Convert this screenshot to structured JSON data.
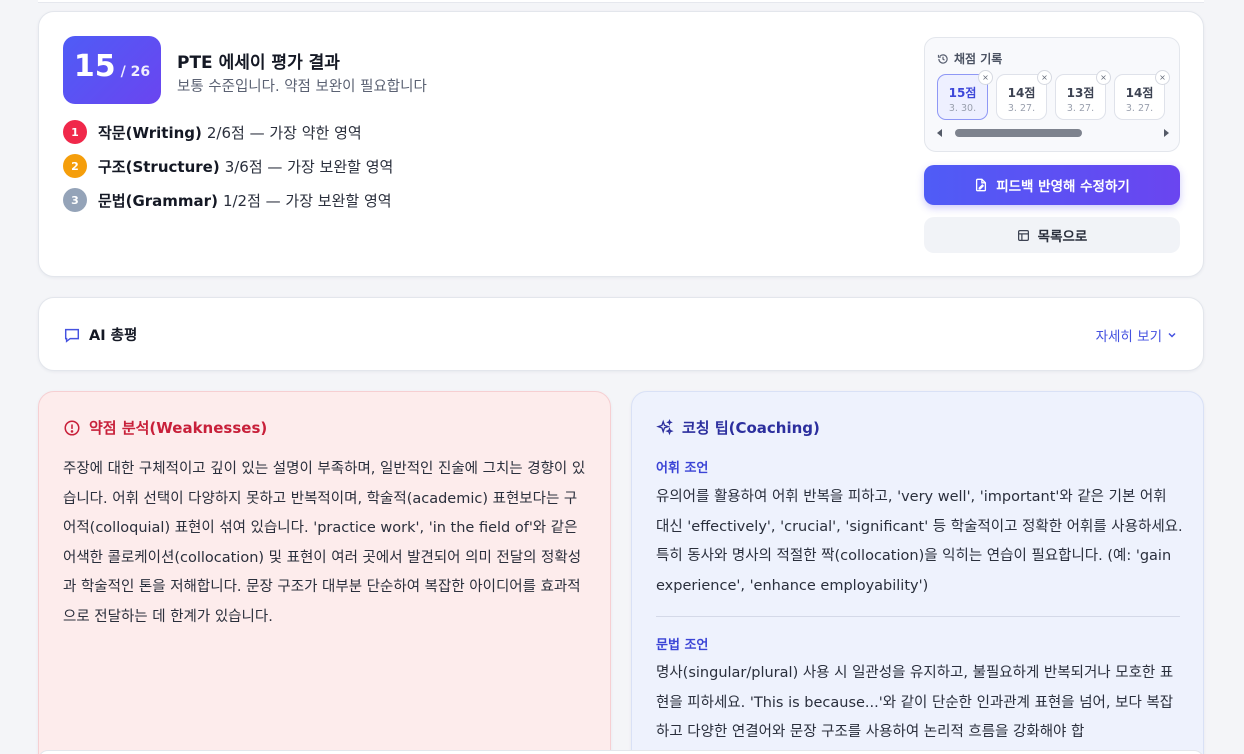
{
  "result": {
    "score": "15",
    "score_total": "/ 26",
    "title": "PTE 에세이 평가 결과",
    "subtitle": "보통 수준입니다. 약점 보완이 필요합니다",
    "weak_items": [
      {
        "num": "1",
        "name": "작문(Writing)",
        "detail": "2/6점 — 가장 약한 영역",
        "color": "#f0284a"
      },
      {
        "num": "2",
        "name": "구조(Structure)",
        "detail": "3/6점 — 가장 보완할 영역",
        "color": "#f59e0b"
      },
      {
        "num": "3",
        "name": "문법(Grammar)",
        "detail": "1/2점 — 가장 보완할 영역",
        "color": "#94a3b8"
      }
    ]
  },
  "history": {
    "label": "채점 기록",
    "items": [
      {
        "score": "15점",
        "date": "3. 30.",
        "active": true
      },
      {
        "score": "14점",
        "date": "3. 27.",
        "active": false
      },
      {
        "score": "13점",
        "date": "3. 27.",
        "active": false
      },
      {
        "score": "14점",
        "date": "3. 27.",
        "active": false
      }
    ],
    "remove_glyph": "×"
  },
  "buttons": {
    "revise": "피드백 반영해 수정하기",
    "list": "목록으로"
  },
  "summary": {
    "title": "AI 총평",
    "detail_link": "자세히 보기"
  },
  "weaknesses": {
    "title": "약점 분석(Weaknesses)",
    "body": "주장에 대한 구체적이고 깊이 있는 설명이 부족하며, 일반적인 진술에 그치는 경향이 있습니다. 어휘 선택이 다양하지 못하고 반복적이며, 학술적(academic) 표현보다는 구어적(colloquial) 표현이 섞여 있습니다. 'practice work', 'in the field of'와 같은 어색한 콜로케이션(collocation) 및 표현이 여러 곳에서 발견되어 의미 전달의 정확성과 학술적인 톤을 저해합니다. 문장 구조가 대부분 단순하여 복잡한 아이디어를 효과적으로 전달하는 데 한계가 있습니다."
  },
  "coaching": {
    "title": "코칭 팁(Coaching)",
    "sections": [
      {
        "title": "어휘 조언",
        "body": "유의어를 활용하여 어휘 반복을 피하고, 'very well', 'important'와 같은 기본 어휘 대신 'effectively', 'crucial', 'significant' 등 학술적이고 정확한 어휘를 사용하세요. 특히 동사와 명사의 적절한 짝(collocation)을 익히는 연습이 필요합니다. (예: 'gain experience', 'enhance employability')"
      },
      {
        "title": "문법 조언",
        "body": "명사(singular/plural) 사용 시 일관성을 유지하고, 불필요하게 반복되거나 모호한 표현을 피하세요. 'This is because...'와 같이 단순한 인과관계 표현을 넘어, 보다 복잡하고 다양한 연결어와 문장 구조를 사용하여 논리적 흐름을 강화해야 합"
      }
    ]
  },
  "colors": {
    "accent": "#4f5cf6",
    "weak_bg": "#fdecec",
    "weak_text": "#c8203a",
    "coach_bg": "#eef2fd",
    "coach_text": "#2c2f9e"
  }
}
